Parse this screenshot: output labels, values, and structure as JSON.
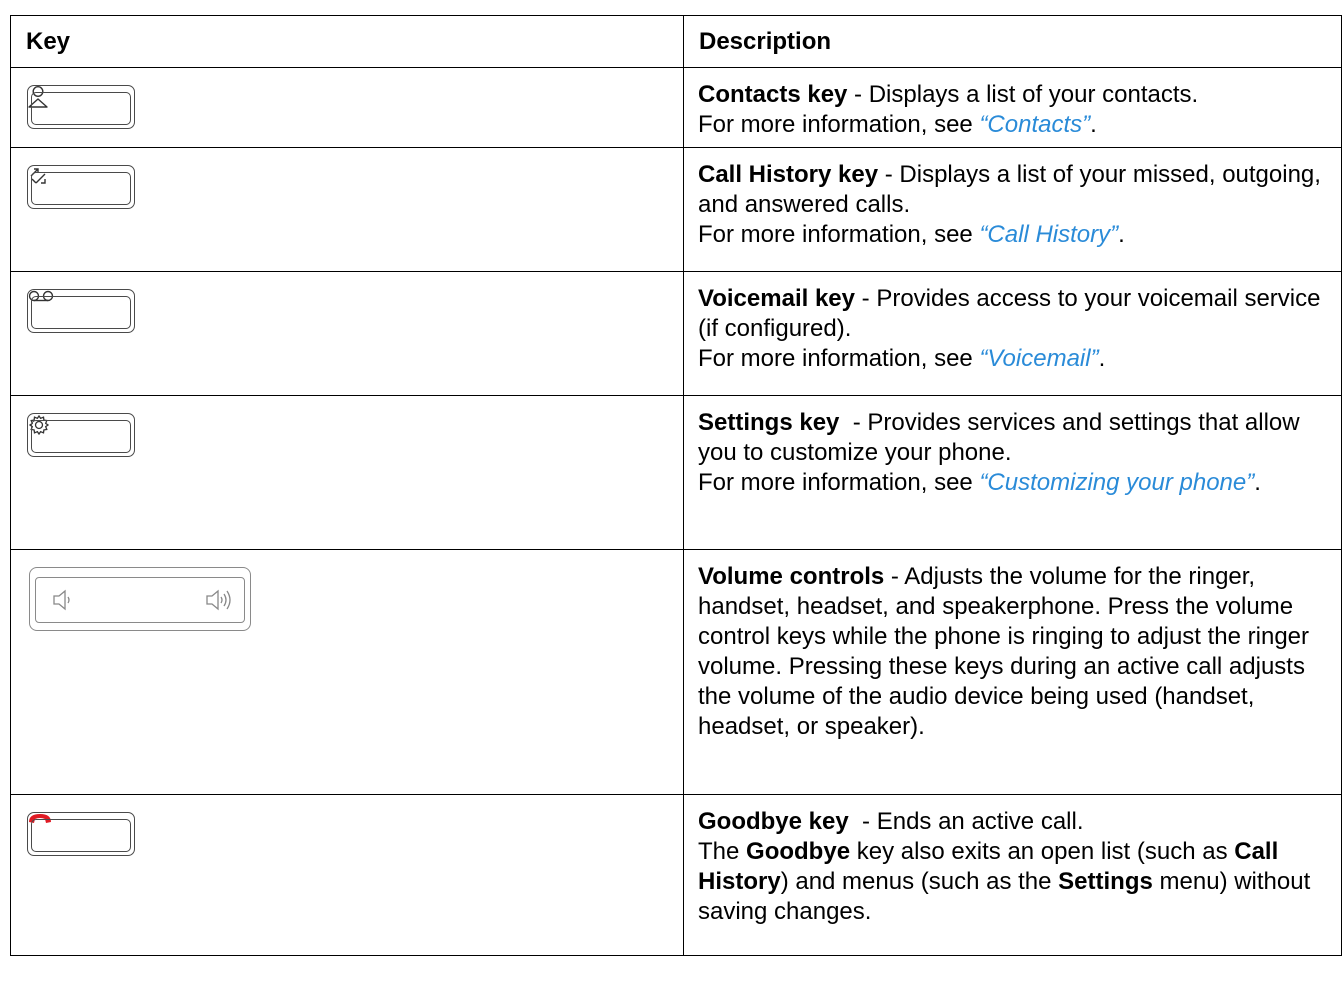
{
  "table": {
    "headers": {
      "key": "Key",
      "description": "Description"
    },
    "more_info_prefix": "For more information, see ",
    "rows": [
      {
        "icon": "contacts-icon",
        "title": "Contacts key",
        "text": " - Displays a list of your contacts.",
        "link": "“Contacts”"
      },
      {
        "icon": "call-history-icon",
        "title": "Call History key",
        "text": " - Displays a list of your missed, outgoing, and answered calls.",
        "link": "“Call History”"
      },
      {
        "icon": "voicemail-icon",
        "title": "Voicemail key",
        "text": " - Provides access to your voicemail service (if configured).",
        "link": "“Voicemail”"
      },
      {
        "icon": "settings-icon",
        "title": "Settings key",
        "text": "  - Provides services and settings that allow you to customize your phone.",
        "link": "“Customizing your phone”"
      },
      {
        "icon": "volume-icon",
        "title": "Volume controls",
        "text": " - Adjusts the volume for the ringer, handset, headset, and speakerphone. Press the volume control keys while the phone is ringing to adjust the ringer volume. Pressing these keys during an active call adjusts the volume of the audio device being used (handset, headset, or speaker)."
      },
      {
        "icon": "hang-up-icon",
        "title": "Goodbye key",
        "text": "  - Ends an active call.",
        "line2": [
          "The ",
          "Goodbye",
          " key also exits an open list (such as ",
          "Call History",
          ") and menus (such as the ",
          "Settings",
          " menu) without saving changes."
        ]
      }
    ]
  },
  "colors": {
    "link": "#2a8bd8",
    "hangup": "#e01b24"
  }
}
